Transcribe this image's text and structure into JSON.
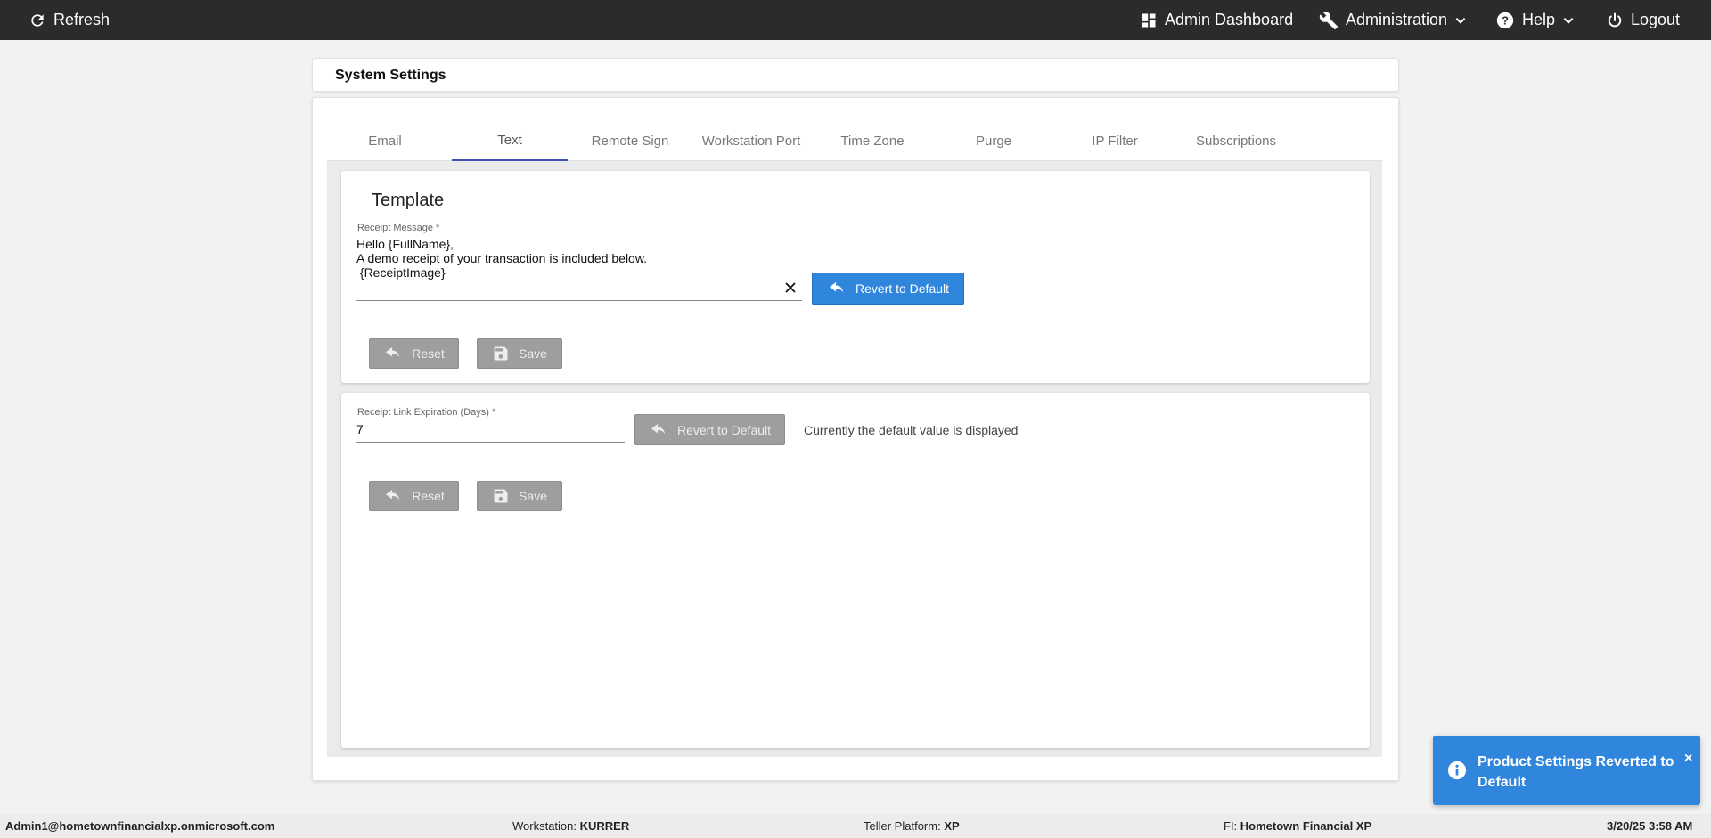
{
  "topbar": {
    "refresh_label": "Refresh",
    "admin_dashboard_label": "Admin Dashboard",
    "administration_label": "Administration",
    "help_label": "Help",
    "logout_label": "Logout"
  },
  "page": {
    "title": "System Settings"
  },
  "tabs": [
    {
      "label": "Email"
    },
    {
      "label": "Text"
    },
    {
      "label": "Remote Sign"
    },
    {
      "label": "Workstation Port"
    },
    {
      "label": "Time Zone"
    },
    {
      "label": "Purge"
    },
    {
      "label": "IP Filter"
    },
    {
      "label": "Subscriptions"
    }
  ],
  "active_tab": "Text",
  "template_card": {
    "title": "Template",
    "receipt_message_label": "Receipt Message",
    "required_marker": " *",
    "receipt_message_lines": [
      "Hello {FullName},",
      "A demo receipt of your transaction is included below.",
      " {ReceiptImage}"
    ],
    "revert_label": "Revert to Default",
    "reset_label": "Reset",
    "save_label": "Save"
  },
  "expiration_card": {
    "label": "Receipt Link Expiration (Days)",
    "required_marker": " *",
    "value": "7",
    "revert_label": "Revert to Default",
    "hint": "Currently the default value is displayed",
    "reset_label": "Reset",
    "save_label": "Save"
  },
  "statusbar": {
    "user": "Admin1@hometownfinancialxp.onmicrosoft.com",
    "workstation_label": "Workstation: ",
    "workstation_value": "KURRER",
    "platform_label": "Teller Platform: ",
    "platform_value": "XP",
    "fi_label": "FI: ",
    "fi_value": "Hometown Financial XP",
    "datetime": "3/20/25 3:58 AM"
  },
  "toast": {
    "message": "Product Settings Reverted to Default",
    "close": "×"
  },
  "colors": {
    "topbar": "#2b2b2b",
    "accent_blue": "#2f86dc",
    "tab_indicator": "#3f51b5",
    "disabled_button": "#9e9e9e"
  },
  "icons": [
    "refresh-icon",
    "dashboard-icon",
    "wrench-icon",
    "chevron-down-icon",
    "help-icon",
    "power-icon",
    "undo-icon",
    "save-icon",
    "close-icon",
    "info-icon"
  ]
}
